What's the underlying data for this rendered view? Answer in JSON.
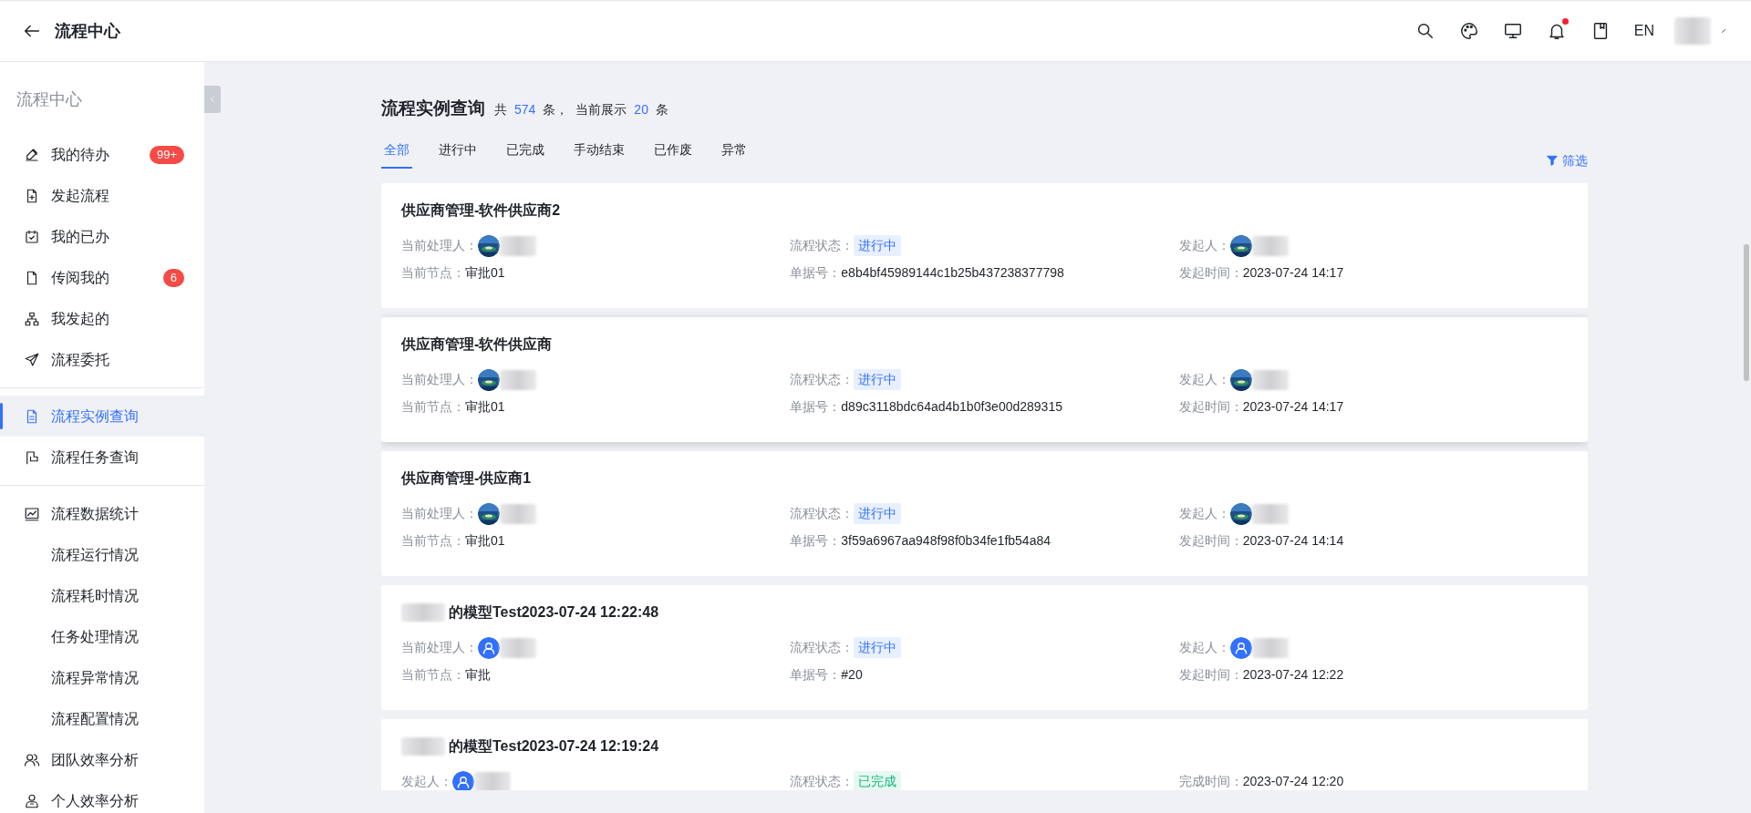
{
  "header": {
    "title": "流程中心",
    "language": "EN",
    "notification_dot": true
  },
  "sidebar": {
    "title": "流程中心",
    "groups": [
      [
        {
          "label": "我的待办",
          "selected": false,
          "badge": "99+"
        },
        {
          "label": "发起流程",
          "selected": false
        },
        {
          "label": "我的已办",
          "selected": false
        },
        {
          "label": "传阅我的",
          "selected": false,
          "badge": "6"
        },
        {
          "label": "我发起的",
          "selected": false
        },
        {
          "label": "流程委托",
          "selected": false
        }
      ],
      [
        {
          "label": "流程实例查询",
          "selected": true
        },
        {
          "label": "流程任务查询",
          "selected": false
        }
      ],
      [
        {
          "label": "流程数据统计",
          "selected": false,
          "children": [
            {
              "label": "流程运行情况",
              "selected": false
            },
            {
              "label": "流程耗时情况",
              "selected": false
            },
            {
              "label": "任务处理情况",
              "selected": false
            },
            {
              "label": "流程异常情况",
              "selected": false
            },
            {
              "label": "流程配置情况",
              "selected": false
            }
          ]
        },
        {
          "label": "团队效率分析",
          "selected": false
        },
        {
          "label": "个人效率分析",
          "selected": false
        }
      ]
    ]
  },
  "page": {
    "title": "流程实例查询",
    "total_prefix": "共",
    "total": "574",
    "total_unit": "条，",
    "shown_prefix": "当前展示",
    "shown": "20",
    "shown_unit": "条"
  },
  "tabs": [
    {
      "label": "全部",
      "selected": true
    },
    {
      "label": "进行中",
      "selected": false
    },
    {
      "label": "已完成",
      "selected": false
    },
    {
      "label": "手动结束",
      "selected": false
    },
    {
      "label": "已作废",
      "selected": false
    },
    {
      "label": "异常",
      "selected": false
    }
  ],
  "filter": {
    "label": "筛选"
  },
  "cards": [
    {
      "title": "供应商管理-软件供应商2",
      "title_redacted": false,
      "hovered": false,
      "lines": [
        [
          {
            "kind": "person",
            "label": "当前处理人：",
            "photo": true
          },
          {
            "kind": "status",
            "label": "流程状态：",
            "value": "进行中",
            "completed": false
          },
          {
            "kind": "person",
            "label": "发起人：",
            "photo": true
          }
        ],
        [
          {
            "kind": "text",
            "label": "当前节点：",
            "value": "审批01"
          },
          {
            "kind": "text",
            "label": "单据号：",
            "value": "e8b4bf45989144c1b25b437238377798"
          },
          {
            "kind": "text",
            "label": "发起时间：",
            "value": "2023-07-24 14:17"
          }
        ]
      ]
    },
    {
      "title": "供应商管理-软件供应商",
      "title_redacted": false,
      "hovered": true,
      "lines": [
        [
          {
            "kind": "person",
            "label": "当前处理人：",
            "photo": true
          },
          {
            "kind": "status",
            "label": "流程状态：",
            "value": "进行中",
            "completed": false
          },
          {
            "kind": "person",
            "label": "发起人：",
            "photo": true
          }
        ],
        [
          {
            "kind": "text",
            "label": "当前节点：",
            "value": "审批01"
          },
          {
            "kind": "text",
            "label": "单据号：",
            "value": "d89c3118bdc64ad4b1b0f3e00d289315"
          },
          {
            "kind": "text",
            "label": "发起时间：",
            "value": "2023-07-24 14:17"
          }
        ]
      ]
    },
    {
      "title": "供应商管理-供应商1",
      "title_redacted": false,
      "hovered": false,
      "lines": [
        [
          {
            "kind": "person",
            "label": "当前处理人：",
            "photo": true
          },
          {
            "kind": "status",
            "label": "流程状态：",
            "value": "进行中",
            "completed": false
          },
          {
            "kind": "person",
            "label": "发起人：",
            "photo": true
          }
        ],
        [
          {
            "kind": "text",
            "label": "当前节点：",
            "value": "审批01"
          },
          {
            "kind": "text",
            "label": "单据号：",
            "value": "3f59a6967aa948f98f0b34fe1fb54a84"
          },
          {
            "kind": "text",
            "label": "发起时间：",
            "value": "2023-07-24 14:14"
          }
        ]
      ]
    },
    {
      "title": "的模型Test2023-07-24 12:22:48",
      "title_redacted": true,
      "hovered": false,
      "lines": [
        [
          {
            "kind": "person",
            "label": "当前处理人：",
            "photo": false
          },
          {
            "kind": "status",
            "label": "流程状态：",
            "value": "进行中",
            "completed": false
          },
          {
            "kind": "person",
            "label": "发起人：",
            "photo": false
          }
        ],
        [
          {
            "kind": "text",
            "label": "当前节点：",
            "value": "审批"
          },
          {
            "kind": "text",
            "label": "单据号：",
            "value": "#20"
          },
          {
            "kind": "text",
            "label": "发起时间：",
            "value": "2023-07-24 12:22"
          }
        ]
      ]
    },
    {
      "title": "的模型Test2023-07-24 12:19:24",
      "title_redacted": true,
      "hovered": false,
      "lines": [
        [
          {
            "kind": "person",
            "label": "发起人：",
            "photo": false
          },
          {
            "kind": "status",
            "label": "流程状态：",
            "value": "已完成",
            "completed": true
          },
          {
            "kind": "text",
            "label": "完成时间：",
            "value": "2023-07-24 12:20"
          }
        ]
      ]
    }
  ]
}
